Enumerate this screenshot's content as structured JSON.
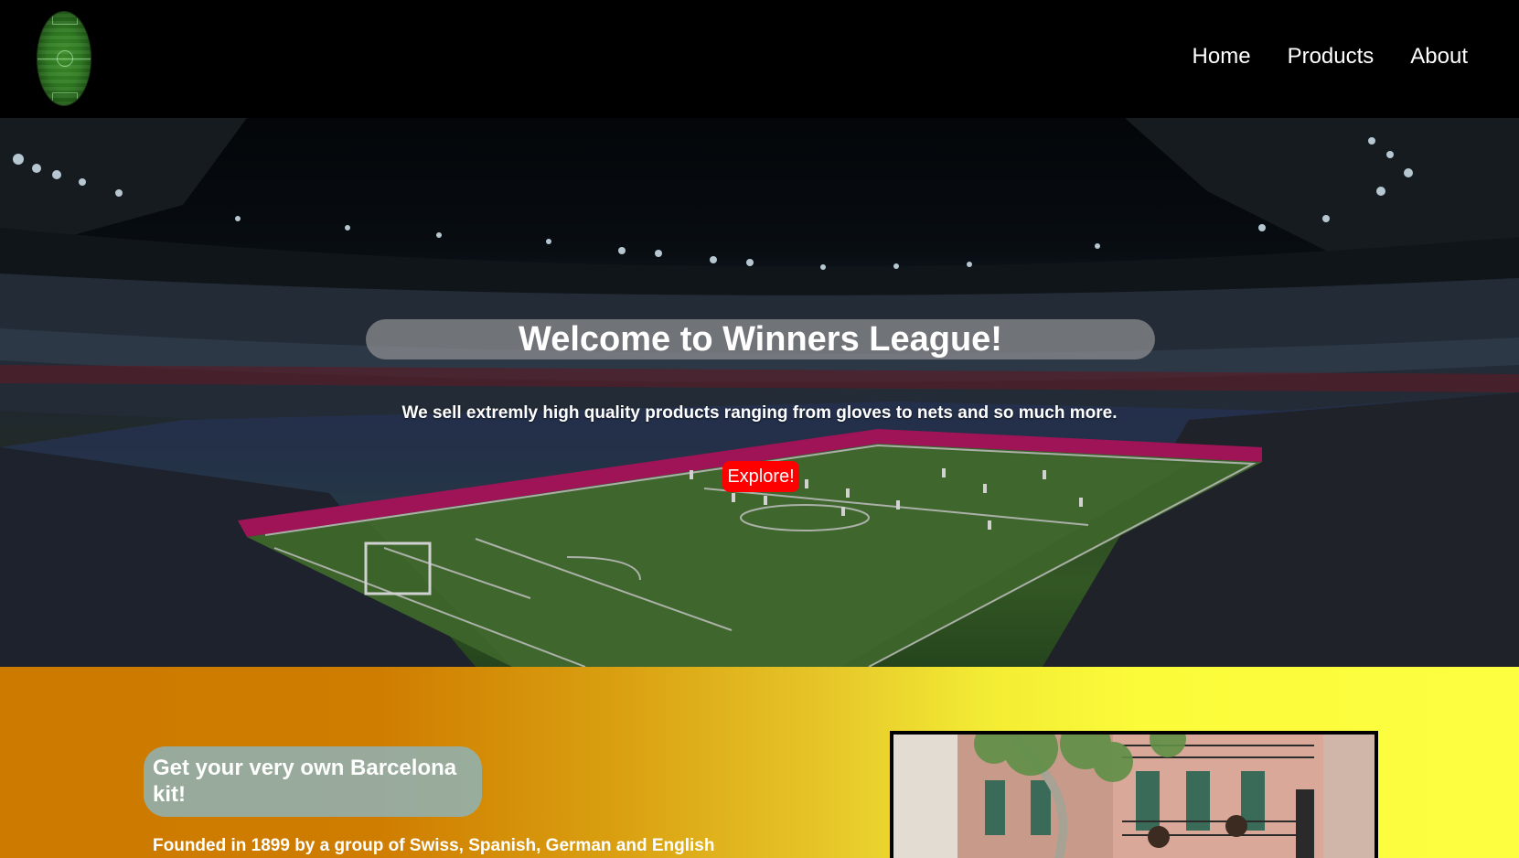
{
  "header": {
    "logo_icon": "football-pitch-logo-icon",
    "nav": [
      {
        "label": "Home"
      },
      {
        "label": "Products"
      },
      {
        "label": "About"
      }
    ]
  },
  "hero": {
    "title": "Welcome to Winners League!",
    "subtitle": "We sell extremly high quality products ranging from gloves to nets and so much more.",
    "cta_label": "Explore!",
    "cta_color": "#ff0000",
    "background": "stadium-night-photo"
  },
  "feature": {
    "title": "Get your very own Barcelona kit!",
    "description": "Founded in 1899 by a group of Swiss, Spanish, German and English",
    "image": "barcelona-street-photo",
    "gradient_start": "#cc7a00",
    "gradient_end": "#fdfe40"
  }
}
